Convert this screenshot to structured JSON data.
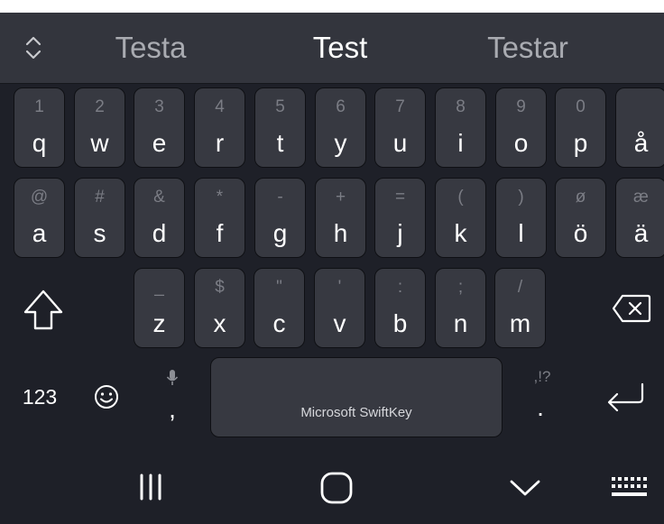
{
  "suggestions": {
    "left": "Testa",
    "center": "Test",
    "right": "Testar"
  },
  "rows": [
    [
      {
        "alt": "1",
        "main": "q"
      },
      {
        "alt": "2",
        "main": "w"
      },
      {
        "alt": "3",
        "main": "e"
      },
      {
        "alt": "4",
        "main": "r"
      },
      {
        "alt": "5",
        "main": "t"
      },
      {
        "alt": "6",
        "main": "y"
      },
      {
        "alt": "7",
        "main": "u"
      },
      {
        "alt": "8",
        "main": "i"
      },
      {
        "alt": "9",
        "main": "o"
      },
      {
        "alt": "0",
        "main": "p"
      },
      {
        "alt": "",
        "main": "å"
      }
    ],
    [
      {
        "alt": "@",
        "main": "a"
      },
      {
        "alt": "#",
        "main": "s"
      },
      {
        "alt": "&",
        "main": "d"
      },
      {
        "alt": "*",
        "main": "f"
      },
      {
        "alt": "-",
        "main": "g"
      },
      {
        "alt": "+",
        "main": "h"
      },
      {
        "alt": "=",
        "main": "j"
      },
      {
        "alt": "(",
        "main": "k"
      },
      {
        "alt": ")",
        "main": "l"
      },
      {
        "alt": "ø",
        "main": "ö"
      },
      {
        "alt": "æ",
        "main": "ä"
      }
    ],
    [
      {
        "alt": "_",
        "main": "z"
      },
      {
        "alt": "$",
        "main": "x"
      },
      {
        "alt": "\"",
        "main": "c"
      },
      {
        "alt": "'",
        "main": "v"
      },
      {
        "alt": ":",
        "main": "b"
      },
      {
        "alt": ";",
        "main": "n"
      },
      {
        "alt": "/",
        "main": "m"
      }
    ]
  ],
  "bottom_row": {
    "numbers_label": "123",
    "comma": ",",
    "period": ".",
    "period_alt": ",!?",
    "space_label": "Microsoft SwiftKey"
  },
  "icons": {
    "expand": "expand-collapse-icon",
    "shift": "shift-icon",
    "backspace": "backspace-icon",
    "emoji": "emoji-icon",
    "mic": "microphone-icon",
    "enter": "enter-icon",
    "recent": "recent-apps-icon",
    "home": "home-icon",
    "hide": "hide-keyboard-icon",
    "keyboard": "keyboard-switch-icon"
  },
  "colors": {
    "background": "#1e2028",
    "key": "#373941",
    "suggestion_bar": "#33353d",
    "secondary_text": "#7b7d85"
  }
}
